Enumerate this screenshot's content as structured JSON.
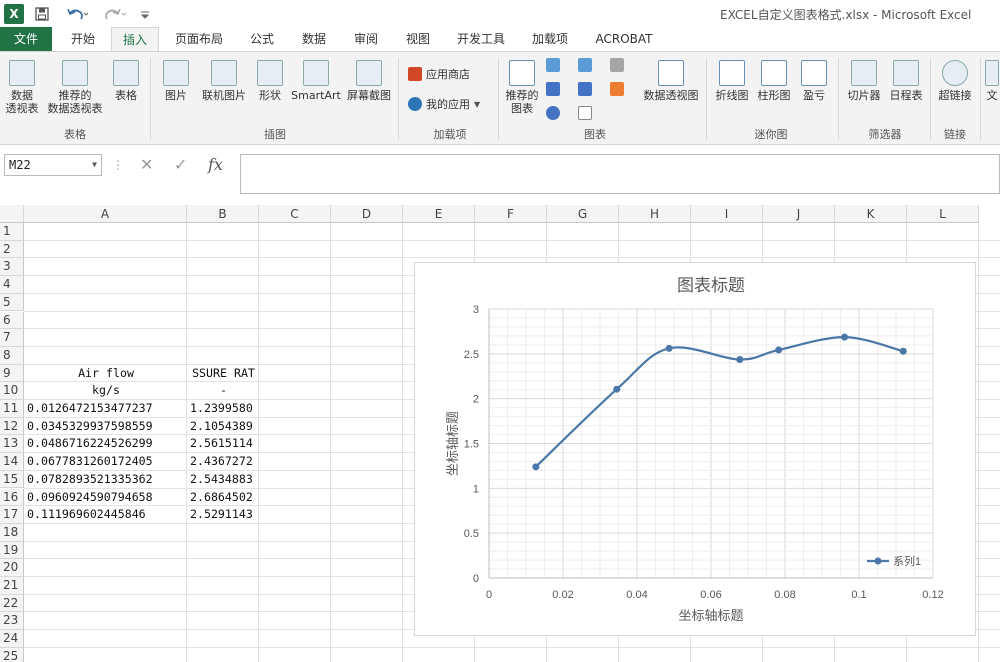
{
  "window": {
    "title": "EXCEL自定义图表格式.xlsx - Microsoft Excel",
    "app_icon": "X",
    "save_icon": "save-icon",
    "undo_icon": "undo-icon",
    "redo_icon": "redo-icon"
  },
  "tabs": [
    "文件",
    "开始",
    "插入",
    "页面布局",
    "公式",
    "数据",
    "审阅",
    "视图",
    "开发工具",
    "加载项",
    "ACROBAT"
  ],
  "active_tab": "插入",
  "ribbon": {
    "pivot_table": "数据\n透视表",
    "recommended_pivot": "推荐的\n数据透视表",
    "table": "表格",
    "group_tables": "表格",
    "pictures": "图片",
    "online_pictures": "联机图片",
    "shapes": "形状",
    "smartart": "SmartArt",
    "screenshot": "屏幕截图",
    "group_illustrations": "插图",
    "app_store": "应用商店",
    "my_apps": "我的应用",
    "group_addins": "加载项",
    "recommended_charts": "推荐的\n图表",
    "pivot_chart": "数据透视图",
    "group_charts": "图表",
    "spark_line": "折线图",
    "spark_column": "柱形图",
    "spark_winloss": "盈亏",
    "group_sparklines": "迷你图",
    "slicer": "切片器",
    "timeline": "日程表",
    "group_filters": "筛选器",
    "hyperlink": "超链接",
    "group_links": "链接",
    "text_partial": "文"
  },
  "formula_bar": {
    "name_box": "M22",
    "cancel": "✕",
    "enter": "✓",
    "fx": "fx",
    "formula": ""
  },
  "sheet": {
    "columns": [
      "A",
      "B",
      "C",
      "D",
      "E",
      "F",
      "G",
      "H",
      "I",
      "J",
      "K",
      "L"
    ],
    "rows": [
      "1",
      "2",
      "3",
      "4",
      "5",
      "6",
      "7",
      "8",
      "9",
      "10",
      "11",
      "12",
      "13",
      "14",
      "15",
      "16",
      "17",
      "18",
      "19",
      "20",
      "21",
      "22",
      "23",
      "24",
      "25"
    ],
    "header_row9": [
      "Air flow",
      "SSURE RAT"
    ],
    "header_row10": [
      "kg/s",
      "-"
    ],
    "data": [
      [
        "0.0126472153477237",
        "1.2399580"
      ],
      [
        "0.0345329937598559",
        "2.1054389"
      ],
      [
        "0.0486716224526299",
        "2.5615114"
      ],
      [
        "0.0677831260172405",
        "2.4367272"
      ],
      [
        "0.0782893521335362",
        "2.5434883"
      ],
      [
        "0.0960924590794658",
        "2.6864502"
      ],
      [
        "0.111969602445846",
        "2.5291143"
      ]
    ]
  },
  "chart_data": {
    "type": "scatter",
    "title": "图表标题",
    "xlabel": "坐标轴标题",
    "ylabel": "坐标轴标题",
    "xlim": [
      0,
      0.12
    ],
    "ylim": [
      0,
      3
    ],
    "xticks": [
      "0",
      "0.02",
      "0.04",
      "0.06",
      "0.08",
      "0.1",
      "0.12"
    ],
    "yticks": [
      "0",
      "0.5",
      "1",
      "1.5",
      "2",
      "2.5",
      "3"
    ],
    "grid": true,
    "legend_position": "bottom-right",
    "smooth": true,
    "series": [
      {
        "name": "系列1",
        "color": "#4a77a8",
        "x": [
          0.0126472153477237,
          0.0345329937598559,
          0.0486716224526299,
          0.0677831260172405,
          0.0782893521335362,
          0.0960924590794658,
          0.111969602445846
        ],
        "y": [
          1.239958,
          2.1054389,
          2.5615114,
          2.4367272,
          2.5434883,
          2.6864502,
          2.5291143
        ]
      }
    ]
  },
  "colors": {
    "excel_green": "#217346",
    "ribbon_bg": "#f3f3f3",
    "series": "#4a77a8"
  }
}
